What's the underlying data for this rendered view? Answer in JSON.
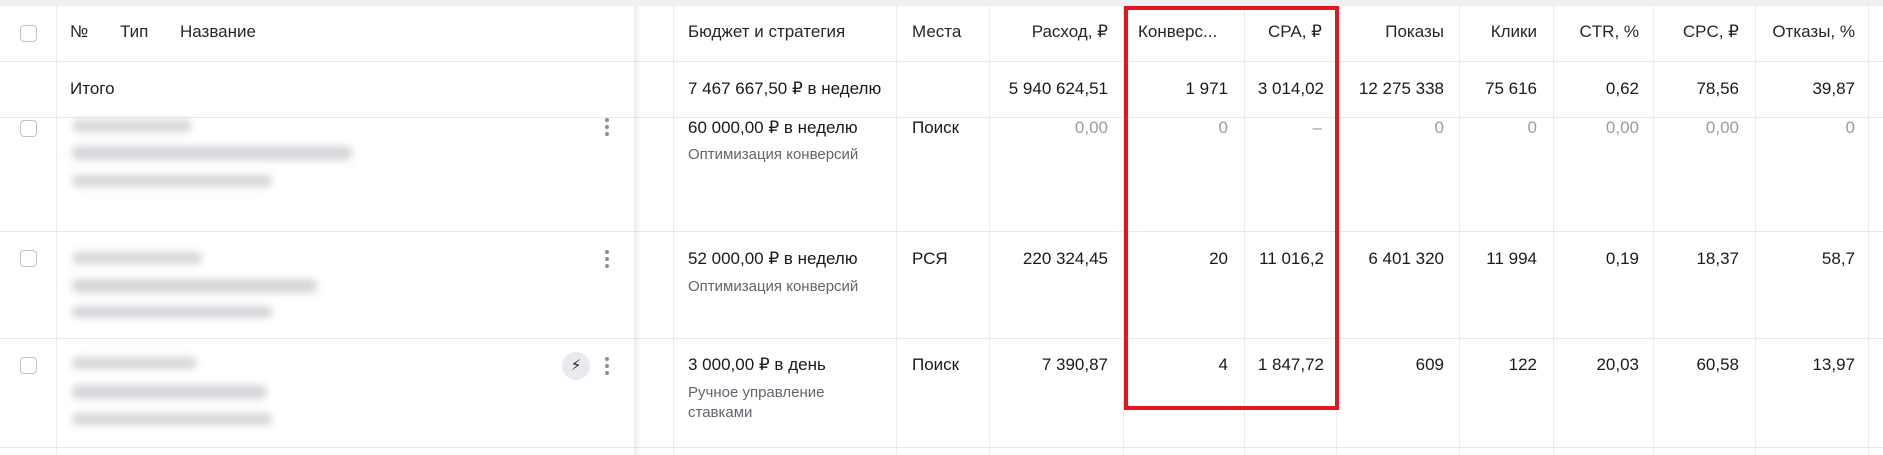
{
  "header": {
    "number": "№",
    "type": "Тип",
    "name": "Название",
    "budget": "Бюджет и стратегия",
    "places": "Места",
    "spend": "Расход, ₽",
    "conversions": "Конверс...",
    "cpa": "CPA, ₽",
    "impressions": "Показы",
    "clicks": "Клики",
    "ctr": "CTR, %",
    "cpc": "CPC, ₽",
    "bounces": "Отказы, %"
  },
  "total": {
    "label": "Итого",
    "budget": "7 467 667,50 ₽ в неделю",
    "spend": "5 940 624,51",
    "conversions": "1 971",
    "cpa": "3 014,02",
    "impressions": "12 275 338",
    "clicks": "75 616",
    "ctr": "0,62",
    "cpc": "78,56",
    "bounces": "39,87"
  },
  "rows": [
    {
      "budget": "60 000,00 ₽ в неделю",
      "strategy": "Оптимизация конверсий",
      "places": "Поиск",
      "spend": "0,00",
      "conversions": "0",
      "cpa": "–",
      "impressions": "0",
      "clicks": "0",
      "ctr": "0,00",
      "cpc": "0,00",
      "bounces": "0"
    },
    {
      "budget": "52 000,00 ₽ в неделю",
      "strategy": "Оптимизация конверсий",
      "places": "РСЯ",
      "spend": "220 324,45",
      "conversions": "20",
      "cpa": "11 016,2",
      "impressions": "6 401 320",
      "clicks": "11 994",
      "ctr": "0,19",
      "cpc": "18,37",
      "bounces": "58,7"
    },
    {
      "budget": "3 000,00 ₽ в день",
      "strategy_line1": "Ручное управление",
      "strategy_line2": "ставками",
      "places": "Поиск",
      "spend": "7 390,87",
      "conversions": "4",
      "cpa": "1 847,72",
      "impressions": "609",
      "clicks": "122",
      "ctr": "20,03",
      "cpc": "60,58",
      "bounces": "13,97"
    }
  ],
  "icons": {
    "row3_badge": "lightning-icon",
    "row_menu": "more-vertical-icon"
  },
  "colors": {
    "highlight": "#e4151d",
    "muted_text": "#9c9c9c"
  }
}
